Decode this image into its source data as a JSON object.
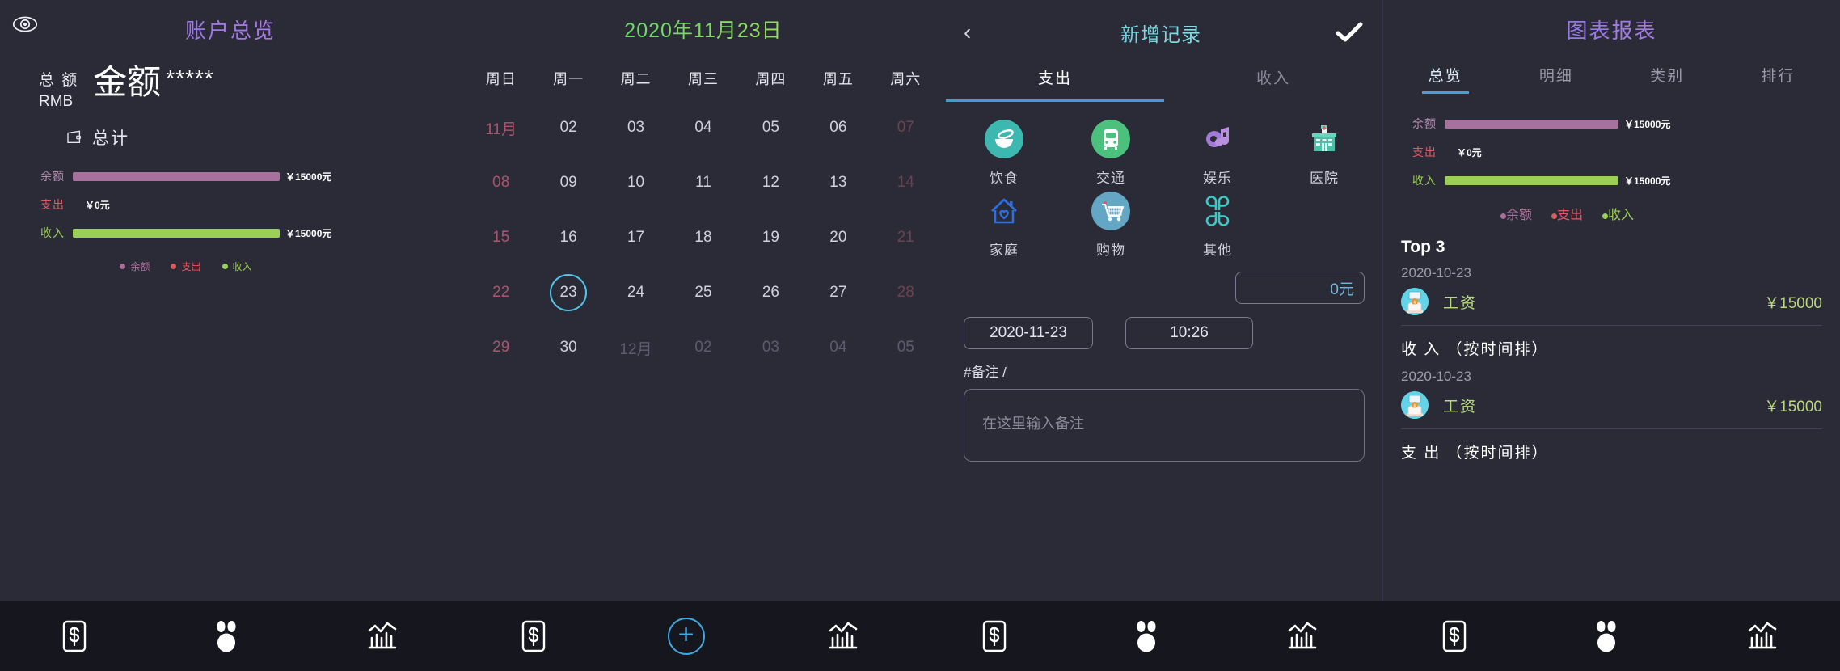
{
  "accounts": {
    "title": "账户总览",
    "eye_icon": "eye-icon",
    "total_label_line1": "总 额",
    "total_label_line2": "RMB",
    "amount_text": "金额",
    "amount_masked": "*****",
    "wallet_icon": "wallet-icon",
    "wallet_label": "总计",
    "bars": [
      {
        "name": "余额",
        "value": "￥15000元",
        "color": "#a8709d",
        "pct": 100,
        "name_color": "#b88fb2"
      },
      {
        "name": "支出",
        "value": "￥0元",
        "color": "#e05a62",
        "pct": 0,
        "name_color": "#e05a62"
      },
      {
        "name": "收入",
        "value": "￥15000元",
        "color": "#9ccf55",
        "pct": 100,
        "name_color": "#9ccf55"
      }
    ],
    "legend": [
      {
        "label": "余额",
        "color": "#a8709d"
      },
      {
        "label": "支出",
        "color": "#e05a62"
      },
      {
        "label": "收入",
        "color": "#9ccf55"
      }
    ]
  },
  "calendar": {
    "title": "2020年11月23日",
    "weekdays": [
      "周日",
      "周一",
      "周二",
      "周三",
      "周四",
      "周五",
      "周六"
    ],
    "selected_day": "23",
    "selected_ring_color": "#54c5e8",
    "days": [
      {
        "t": "11月",
        "k": "wk"
      },
      {
        "t": "02",
        "k": "norm"
      },
      {
        "t": "03",
        "k": "norm"
      },
      {
        "t": "04",
        "k": "norm"
      },
      {
        "t": "05",
        "k": "norm"
      },
      {
        "t": "06",
        "k": "norm"
      },
      {
        "t": "07",
        "k": "mute-wk"
      },
      {
        "t": "08",
        "k": "wk"
      },
      {
        "t": "09",
        "k": "norm"
      },
      {
        "t": "10",
        "k": "norm"
      },
      {
        "t": "11",
        "k": "norm"
      },
      {
        "t": "12",
        "k": "norm"
      },
      {
        "t": "13",
        "k": "norm"
      },
      {
        "t": "14",
        "k": "mute-wk"
      },
      {
        "t": "15",
        "k": "wk"
      },
      {
        "t": "16",
        "k": "norm"
      },
      {
        "t": "17",
        "k": "norm"
      },
      {
        "t": "18",
        "k": "norm"
      },
      {
        "t": "19",
        "k": "norm"
      },
      {
        "t": "20",
        "k": "norm"
      },
      {
        "t": "21",
        "k": "mute-wk"
      },
      {
        "t": "22",
        "k": "wk"
      },
      {
        "t": "23",
        "k": "sel"
      },
      {
        "t": "24",
        "k": "norm"
      },
      {
        "t": "25",
        "k": "norm"
      },
      {
        "t": "26",
        "k": "norm"
      },
      {
        "t": "27",
        "k": "norm"
      },
      {
        "t": "28",
        "k": "mute-wk"
      },
      {
        "t": "29",
        "k": "wk"
      },
      {
        "t": "30",
        "k": "norm"
      },
      {
        "t": "12月",
        "k": "mute"
      },
      {
        "t": "02",
        "k": "mute"
      },
      {
        "t": "03",
        "k": "mute"
      },
      {
        "t": "04",
        "k": "mute"
      },
      {
        "t": "05",
        "k": "mute"
      }
    ]
  },
  "new_record": {
    "title": "新增记录",
    "back_icon": "chevron-left-icon",
    "confirm_icon": "check-icon",
    "tabs": [
      {
        "label": "支出",
        "active": true
      },
      {
        "label": "收入",
        "active": false
      }
    ],
    "categories": [
      {
        "label": "饮食",
        "icon": "food-bowl-icon",
        "bg": "#3cb8b0"
      },
      {
        "label": "交通",
        "icon": "bus-icon",
        "bg": "#4cc07d"
      },
      {
        "label": "娱乐",
        "icon": "music-note-icon",
        "bg": "transparent"
      },
      {
        "label": "医院",
        "icon": "hospital-icon",
        "bg": "transparent"
      },
      {
        "label": "家庭",
        "icon": "home-heart-icon",
        "bg": "transparent"
      },
      {
        "label": "购物",
        "icon": "shopping-cart-icon",
        "bg": "#64a7c4"
      },
      {
        "label": "其他",
        "icon": "clover-icon",
        "bg": "transparent"
      }
    ],
    "amount_value": "0元",
    "date_value": "2020-11-23",
    "time_value": "10:26",
    "note_label": "#备注 /",
    "note_placeholder": "在这里输入备注"
  },
  "charts": {
    "title": "图表报表",
    "tabs": [
      {
        "label": "总览",
        "active": true
      },
      {
        "label": "明细",
        "active": false
      },
      {
        "label": "类别",
        "active": false
      },
      {
        "label": "排行",
        "active": false
      }
    ],
    "bars": [
      {
        "name": "余额",
        "value": "￥15000元",
        "color": "#a8709d",
        "pct": 100,
        "name_color": "#b88fb2"
      },
      {
        "name": "支出",
        "value": "￥0元",
        "color": "#e05a62",
        "pct": 0,
        "name_color": "#e05a62"
      },
      {
        "name": "收入",
        "value": "￥15000元",
        "color": "#9ccf55",
        "pct": 100,
        "name_color": "#9ccf55"
      }
    ],
    "legend": [
      {
        "label": "余额",
        "color": "#a8709d"
      },
      {
        "label": "支出",
        "color": "#e05a62"
      },
      {
        "label": "收入",
        "color": "#9ccf55"
      }
    ],
    "top3_title": "Top 3",
    "top3_record": {
      "date": "2020-10-23",
      "name": "工资",
      "amount": "￥15000",
      "icon": "salary-icon"
    },
    "income_header": "收 入 （按时间排）",
    "income_record": {
      "date": "2020-10-23",
      "name": "工资",
      "amount": "￥15000",
      "icon": "salary-icon"
    },
    "expense_header": "支 出 （按时间排）"
  },
  "bottom_nav": {
    "groups": [
      [
        {
          "icon": "money-note-icon",
          "kind": "money"
        },
        {
          "icon": "person-icon",
          "kind": "person"
        },
        {
          "icon": "bar-chart-icon",
          "kind": "chart"
        }
      ],
      [
        {
          "icon": "money-note-icon",
          "kind": "money"
        },
        {
          "icon": "plus-icon",
          "kind": "plus"
        },
        {
          "icon": "bar-chart-icon",
          "kind": "chart"
        }
      ],
      [
        {
          "icon": "money-note-icon",
          "kind": "money"
        },
        {
          "icon": "person-icon",
          "kind": "person"
        },
        {
          "icon": "bar-chart-icon",
          "kind": "chart"
        }
      ],
      [
        {
          "icon": "money-note-icon",
          "kind": "money"
        },
        {
          "icon": "person-icon",
          "kind": "person"
        },
        {
          "icon": "bar-chart-icon",
          "kind": "chart"
        }
      ]
    ],
    "plus_color": "#3fa8dd"
  },
  "chart_data": {
    "type": "bar",
    "title": "账户总览 / 图表报表 — 总览",
    "categories": [
      "余额",
      "支出",
      "收入"
    ],
    "values": [
      15000,
      0,
      15000
    ],
    "unit": "元",
    "currency": "￥",
    "series": [
      {
        "name": "余额",
        "values": [
          15000
        ],
        "color": "#a8709d"
      },
      {
        "name": "支出",
        "values": [
          0
        ],
        "color": "#e05a62"
      },
      {
        "name": "收入",
        "values": [
          15000
        ],
        "color": "#9ccf55"
      }
    ],
    "labels": [
      "￥15000元",
      "￥0元",
      "￥15000元"
    ],
    "xlabel": "",
    "ylabel": "",
    "xlim": [
      0,
      15000
    ],
    "grid": false,
    "legend_position": "bottom",
    "orientation": "horizontal",
    "records": [
      {
        "section": "Top 3",
        "date": "2020-10-23",
        "category": "工资",
        "amount": 15000
      },
      {
        "section": "收 入 （按时间排）",
        "date": "2020-10-23",
        "category": "工资",
        "amount": 15000
      }
    ]
  }
}
